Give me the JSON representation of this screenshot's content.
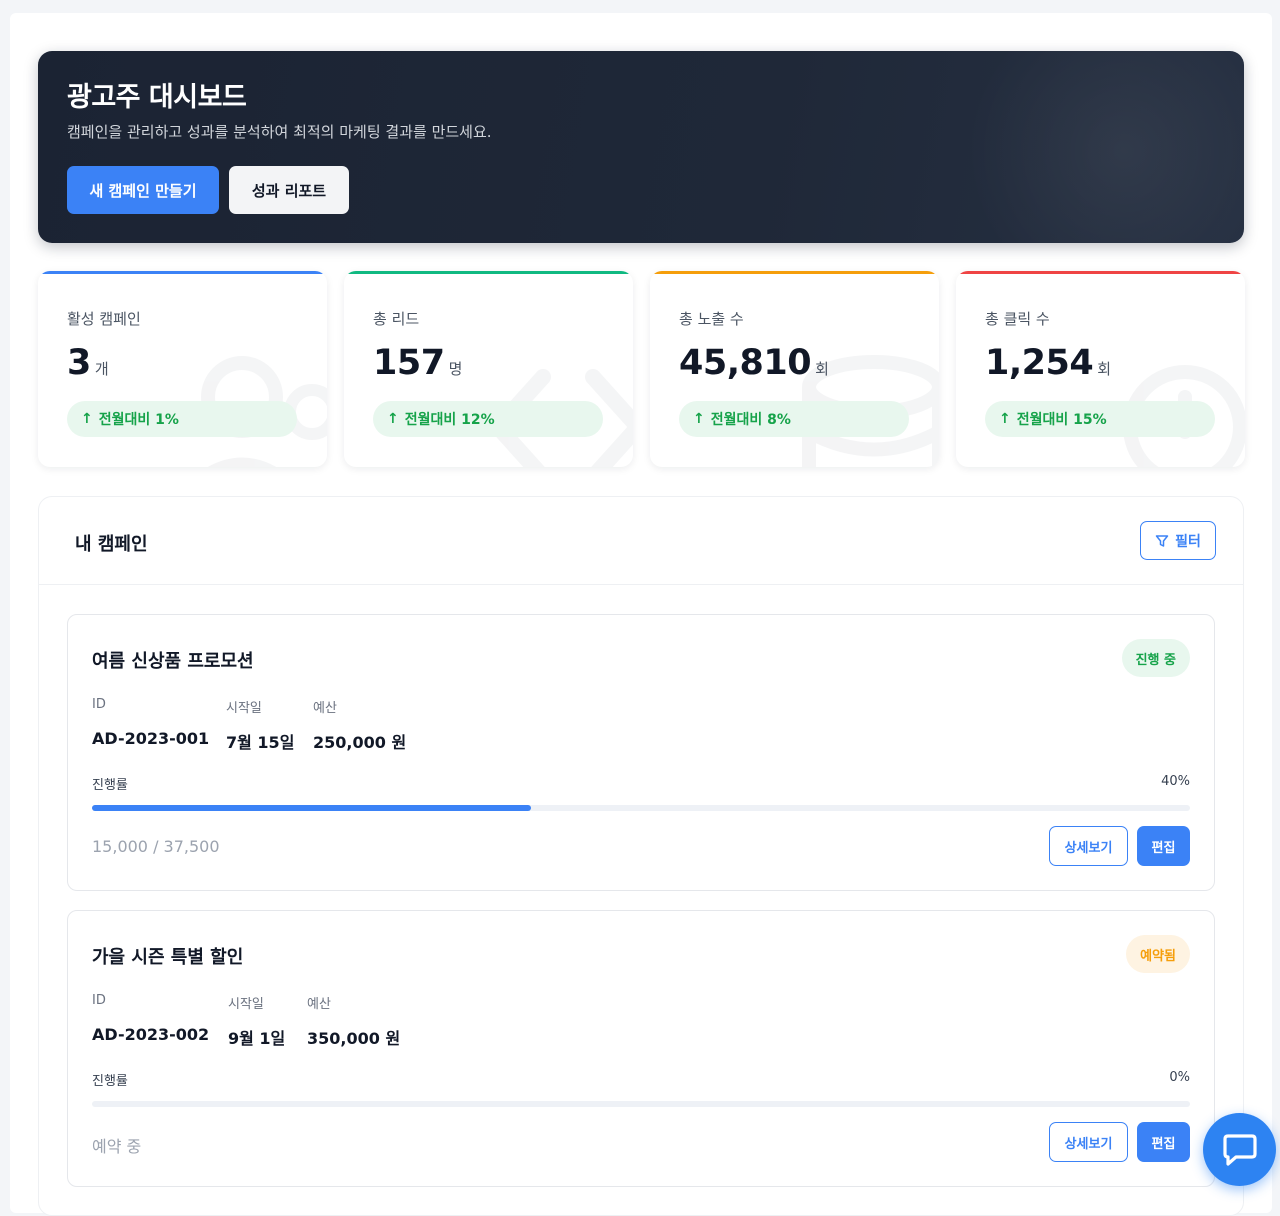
{
  "hero": {
    "title": "광고주 대시보드",
    "subtitle": "캠페인을 관리하고 성과를 분석하여 최적의 마케팅 결과를 만드세요.",
    "primary_label": "새 캠페인 만들기",
    "secondary_label": "성과 리포트"
  },
  "stats": [
    {
      "label": "활성 캠페인",
      "value": "3",
      "unit": "개",
      "trend": "전월대비 1%",
      "color": "#3b82f6",
      "icon": "users-icon"
    },
    {
      "label": "총 리드",
      "value": "157",
      "unit": "명",
      "trend": "전월대비 12%",
      "color": "#10b981",
      "icon": "code-icon"
    },
    {
      "label": "총 노출 수",
      "value": "45,810",
      "unit": "회",
      "trend": "전월대비 8%",
      "color": "#f59e0b",
      "icon": "database-icon"
    },
    {
      "label": "총 클릭 수",
      "value": "1,254",
      "unit": "회",
      "trend": "전월대비 15%",
      "color": "#ef4444",
      "icon": "search-icon"
    }
  ],
  "campaigns_panel": {
    "title": "내 캠페인",
    "filter_label": "필터"
  },
  "campaigns": [
    {
      "name": "여름 신상품 프로모션",
      "status": "진행 중",
      "status_bg": "#e8f7ee",
      "status_fg": "#16a34a",
      "id_label": "ID",
      "id": "AD-2023-001",
      "start_label": "시작일",
      "start": "7월 15일",
      "budget_label": "예산",
      "budget": "250,000 원",
      "progress_label": "진행률",
      "progress_text": "40%",
      "progress": 0.4,
      "footer": "15,000 / 37,500",
      "detail_label": "상세보기",
      "edit_label": "편집"
    },
    {
      "name": "가을 시즌 특별 할인",
      "status": "예약됨",
      "status_bg": "#fef3e2",
      "status_fg": "#f59e0b",
      "id_label": "ID",
      "id": "AD-2023-002",
      "start_label": "시작일",
      "start": "9월 1일",
      "budget_label": "예산",
      "budget": "350,000 원",
      "progress_label": "진행률",
      "progress_text": "0%",
      "progress": 0,
      "footer": "예약 중",
      "detail_label": "상세보기",
      "edit_label": "편집"
    }
  ]
}
